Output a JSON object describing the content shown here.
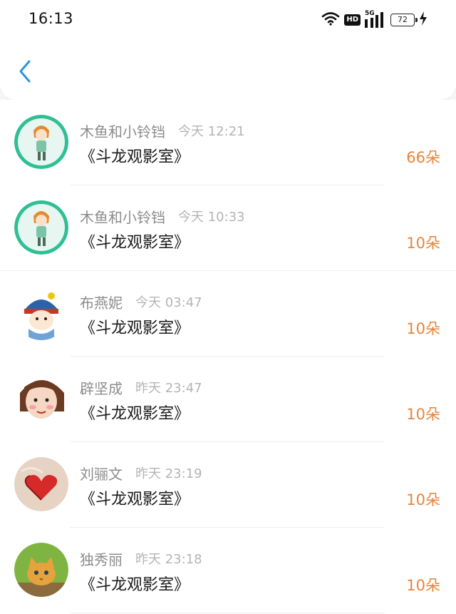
{
  "status_bar": {
    "time": "16:13",
    "battery": "72",
    "network": "5G",
    "hd_label": "HD",
    "icons": [
      "wifi-icon",
      "hd-icon",
      "signal-5g-icon",
      "battery-icon",
      "charging-icon"
    ]
  },
  "header": {
    "back_icon": "chevron-left-icon",
    "accent_color": "#2d95dc"
  },
  "colors": {
    "amount": "#e8843a",
    "name": "#8c8c8c",
    "time": "#b4b4b4",
    "content": "#1a1a1a"
  },
  "items": [
    {
      "name": "木鱼和小铃铛",
      "time": "今天 12:21",
      "content": "《斗龙观影室》",
      "amount": "66朵",
      "avatar": "cartoon-girl-avatar"
    },
    {
      "name": "木鱼和小铃铛",
      "time": "今天 10:33",
      "content": "《斗龙观影室》",
      "amount": "10朵",
      "avatar": "cartoon-girl-avatar"
    },
    {
      "name": "布燕妮",
      "time": "今天 03:47",
      "content": "《斗龙观影室》",
      "amount": "10朵",
      "avatar": "cartoon-boy-avatar"
    },
    {
      "name": "辟坚成",
      "time": "昨天 23:47",
      "content": "《斗龙观影室》",
      "amount": "10朵",
      "avatar": "cartoon-face-avatar"
    },
    {
      "name": "刘骊文",
      "time": "昨天 23:19",
      "content": "《斗龙观影室》",
      "amount": "10朵",
      "avatar": "heart-avatar"
    },
    {
      "name": "独秀丽",
      "time": "昨天 23:18",
      "content": "《斗龙观影室》",
      "amount": "10朵",
      "avatar": "kitten-avatar"
    }
  ]
}
